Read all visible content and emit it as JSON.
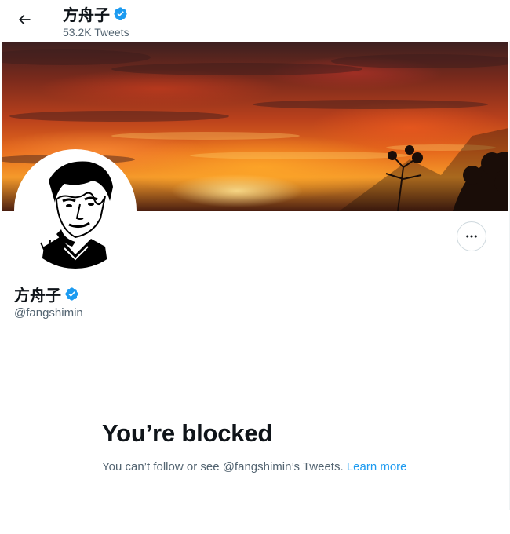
{
  "header": {
    "name": "方舟子",
    "tweet_count": "53.2K Tweets"
  },
  "profile": {
    "name": "方舟子",
    "handle": "@fangshimin"
  },
  "blocked": {
    "title": "You’re blocked",
    "message": "You can’t follow or see @fangshimin’s Tweets.",
    "link_label": "Learn more"
  },
  "colors": {
    "accent": "#1d9bf0",
    "secondary_text": "#536471",
    "primary_text": "#0f1419"
  },
  "icons": {
    "back": "arrow-left-icon",
    "verified": "verified-badge-icon",
    "more": "more-options-icon"
  }
}
